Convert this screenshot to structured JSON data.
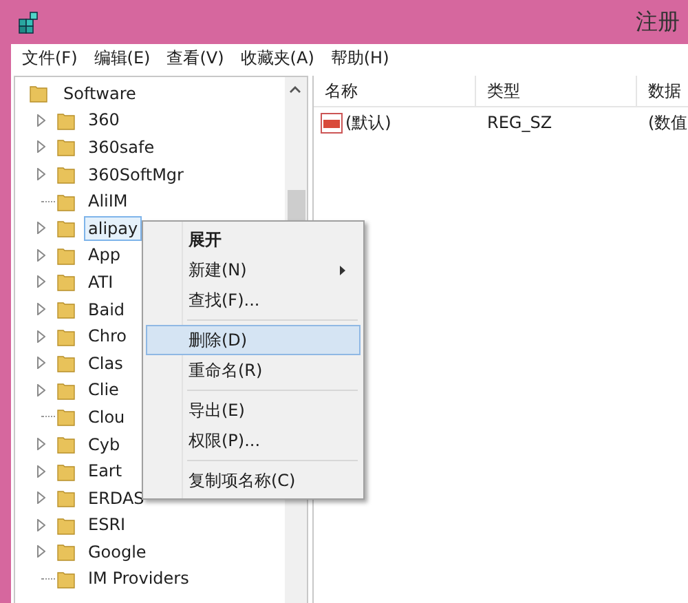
{
  "window": {
    "title": "注册"
  },
  "menu_bar": [
    "文件(F)",
    "编辑(E)",
    "查看(V)",
    "收藏夹(A)",
    "帮助(H)"
  ],
  "tree": {
    "label": "Software",
    "children": [
      {
        "label": "360",
        "expandable": true,
        "selected": false
      },
      {
        "label": "360safe",
        "expandable": true,
        "selected": false
      },
      {
        "label": "360SoftMgr",
        "expandable": true,
        "selected": false
      },
      {
        "label": "AliIM",
        "expandable": false,
        "selected": false
      },
      {
        "label": "alipay",
        "expandable": true,
        "selected": true
      },
      {
        "label": "App",
        "expandable": true,
        "selected": false
      },
      {
        "label": "ATI",
        "expandable": true,
        "selected": false
      },
      {
        "label": "Baid",
        "expandable": true,
        "selected": false
      },
      {
        "label": "Chro",
        "expandable": true,
        "selected": false
      },
      {
        "label": "Clas",
        "expandable": true,
        "selected": false
      },
      {
        "label": "Clie",
        "expandable": true,
        "selected": false
      },
      {
        "label": "Clou",
        "expandable": false,
        "selected": false
      },
      {
        "label": "Cyb",
        "expandable": true,
        "selected": false
      },
      {
        "label": "Eart",
        "expandable": true,
        "selected": false
      },
      {
        "label": "ERDAS",
        "expandable": true,
        "selected": false
      },
      {
        "label": "ESRI",
        "expandable": true,
        "selected": false
      },
      {
        "label": "Google",
        "expandable": true,
        "selected": false
      },
      {
        "label": "IM Providers",
        "expandable": false,
        "selected": false
      }
    ]
  },
  "values_table": {
    "columns": [
      "名称",
      "类型",
      "数据"
    ],
    "rows": [
      {
        "name": "(默认)",
        "type": "REG_SZ",
        "data": "(数值"
      }
    ]
  },
  "context_menu": {
    "items": [
      {
        "kind": "item",
        "label": "展开",
        "default": true,
        "submenu": false,
        "selected": false
      },
      {
        "kind": "item",
        "label": "新建(N)",
        "default": false,
        "submenu": true,
        "selected": false
      },
      {
        "kind": "item",
        "label": "查找(F)...",
        "default": false,
        "submenu": false,
        "selected": false
      },
      {
        "kind": "separator"
      },
      {
        "kind": "item",
        "label": "删除(D)",
        "default": false,
        "submenu": false,
        "selected": true
      },
      {
        "kind": "item",
        "label": "重命名(R)",
        "default": false,
        "submenu": false,
        "selected": false
      },
      {
        "kind": "separator"
      },
      {
        "kind": "item",
        "label": "导出(E)",
        "default": false,
        "submenu": false,
        "selected": false
      },
      {
        "kind": "item",
        "label": "权限(P)...",
        "default": false,
        "submenu": false,
        "selected": false
      },
      {
        "kind": "separator"
      },
      {
        "kind": "item",
        "label": "复制项名称(C)",
        "default": false,
        "submenu": false,
        "selected": false
      }
    ]
  }
}
